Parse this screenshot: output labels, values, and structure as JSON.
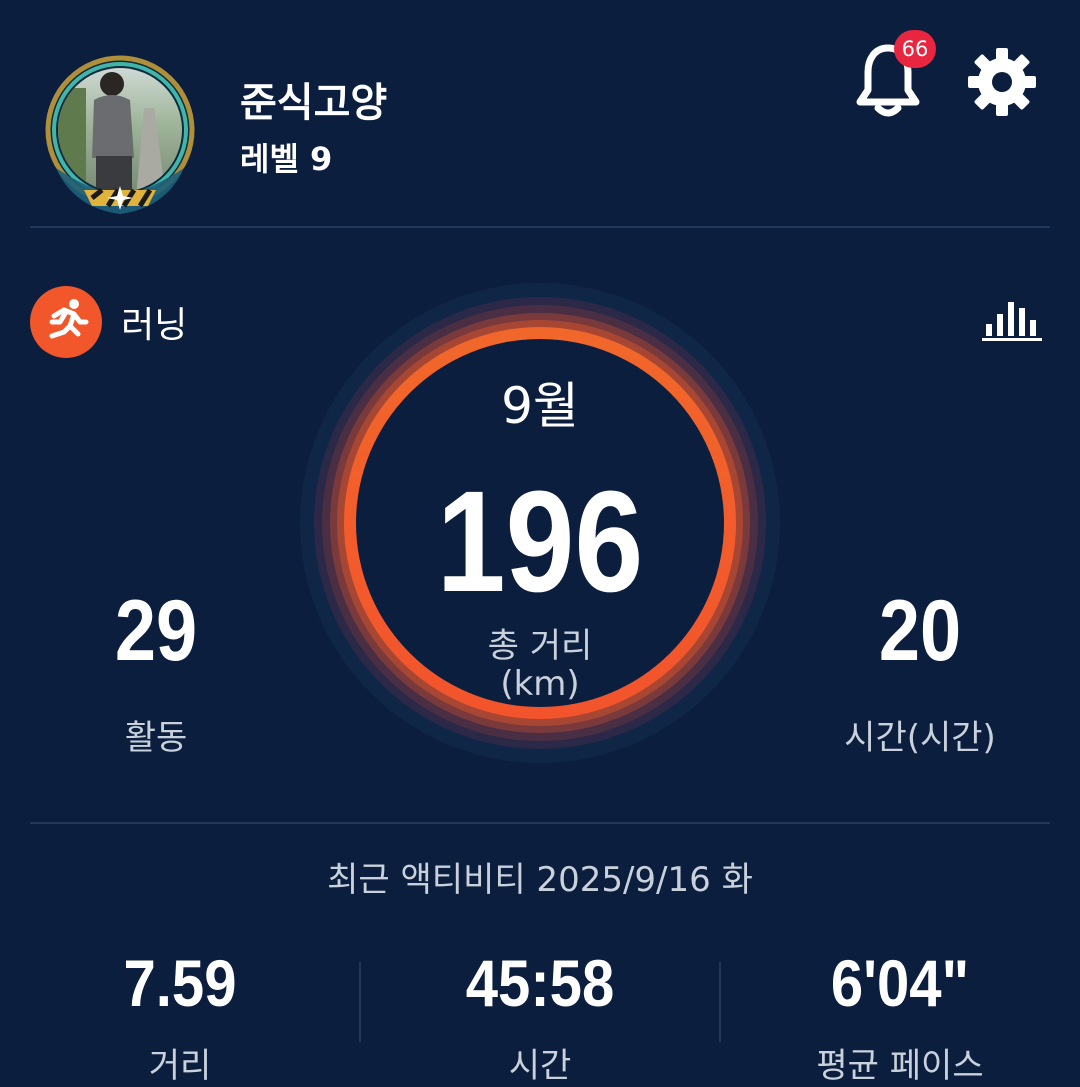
{
  "profile": {
    "username": "준식고양",
    "level": "레벨 9"
  },
  "notifications": {
    "badge_count": "66"
  },
  "activity": {
    "label": "러닝",
    "icon": "running-icon"
  },
  "summary": {
    "month": "9월",
    "total_distance": "196",
    "total_distance_label": "총 거리",
    "total_distance_unit": "(km)",
    "activities_value": "29",
    "activities_label": "활동",
    "hours_value": "20",
    "hours_label": "시간(시간)"
  },
  "recent": {
    "heading": "최근 액티비티 2025/9/16 화",
    "distance_value": "7.59",
    "distance_label": "거리",
    "time_value": "45:58",
    "time_label": "시간",
    "pace_value": "6'04\"",
    "pace_label": "평균 페이스"
  },
  "colors": {
    "background": "#0c1e3d",
    "accent": "#f1572a",
    "badge": "#e8263f",
    "divider": "#22385a"
  }
}
